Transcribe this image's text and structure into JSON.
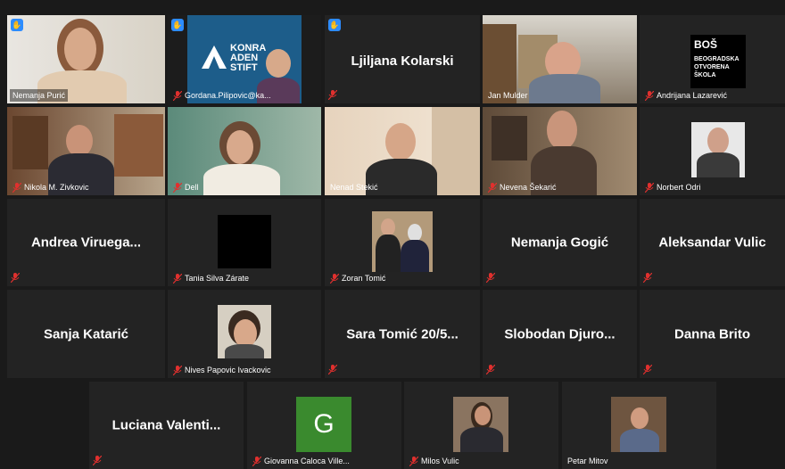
{
  "colors": {
    "active_outline": "#e6e23a",
    "raised_hand": "#2d8cff",
    "muted_mic": "#e0302e",
    "tile_bg": "#232323",
    "meeting_bg": "#1a1a1a"
  },
  "icons": {
    "muted": "muted-mic-icon",
    "hand": "raised-hand-icon"
  },
  "participants": [
    {
      "name": "Nemanja Purić",
      "video": true,
      "muted": false,
      "hand": true,
      "active": true
    },
    {
      "name": "Gordana.Pilipovic@ka...",
      "video": true,
      "muted": true,
      "hand": true,
      "logo_text": [
        "KONRA",
        "ADEN",
        "STIFT"
      ]
    },
    {
      "name": "Ljiljana Kolarski",
      "video": false,
      "muted": true,
      "hand": true
    },
    {
      "name": "Jan Mulder",
      "video": true,
      "muted": false,
      "hand": false
    },
    {
      "name": "Andrijana Lazarević",
      "video": false,
      "muted": true,
      "hand": false,
      "logo_text": [
        "BOŠ",
        "BEOGRADSKA",
        "OTVORENA",
        "ŠKOLA"
      ]
    },
    {
      "name": "Nikola M. Zivkovic",
      "video": true,
      "muted": true,
      "hand": false
    },
    {
      "name": "Dell",
      "video": true,
      "muted": true,
      "hand": false
    },
    {
      "name": "Nenad Stekić",
      "video": true,
      "muted": false,
      "hand": false
    },
    {
      "name": "Nevena Šekarić",
      "video": true,
      "muted": true,
      "hand": false
    },
    {
      "name": "Norbert Odri",
      "video": false,
      "muted": true,
      "hand": false
    },
    {
      "name": "Andrea Viruega...",
      "video": false,
      "muted": true,
      "hand": false
    },
    {
      "name": "Tania Silva Zárate",
      "video": false,
      "muted": true,
      "hand": false
    },
    {
      "name": "Zoran Tomić",
      "video": false,
      "muted": true,
      "hand": false
    },
    {
      "name": "Nemanja Gogić",
      "video": false,
      "muted": true,
      "hand": false
    },
    {
      "name": "Aleksandar Vulic",
      "video": false,
      "muted": true,
      "hand": false
    },
    {
      "name": "Sanja Katarić",
      "video": false,
      "muted": true,
      "hand": false
    },
    {
      "name": "Nives Papovic Ivackovic",
      "video": false,
      "muted": true,
      "hand": false
    },
    {
      "name": "Sara Tomić 20/5...",
      "video": false,
      "muted": true,
      "hand": false
    },
    {
      "name": "Slobodan Djuro...",
      "video": false,
      "muted": true,
      "hand": false
    },
    {
      "name": "Danna Brito",
      "video": false,
      "muted": true,
      "hand": false
    },
    {
      "name": "Luciana Valenti...",
      "video": false,
      "muted": true,
      "hand": false
    },
    {
      "name": "Giovanna Caloca Ville...",
      "video": false,
      "muted": true,
      "hand": false,
      "avatar_letter": "G"
    },
    {
      "name": "Milos Vulic",
      "video": false,
      "muted": true,
      "hand": false
    },
    {
      "name": "Petar Mitov",
      "video": false,
      "muted": false,
      "hand": false
    }
  ]
}
